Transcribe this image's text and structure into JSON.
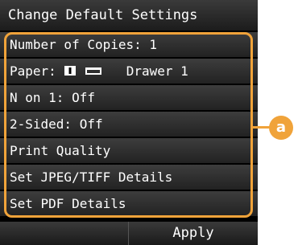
{
  "title": "Change Default Settings",
  "menu_items": [
    {
      "label": "Number of Copies: 1"
    },
    {
      "label": "Paper:",
      "detail": "Drawer 1"
    },
    {
      "label": "N on 1: Off"
    },
    {
      "label": "2-Sided: Off"
    },
    {
      "label": "Print Quality"
    },
    {
      "label": "Set JPEG/TIFF Details"
    },
    {
      "label": "Set PDF Details"
    }
  ],
  "paper_icons": [
    "drawer-number-icon",
    "paper-orientation-icon"
  ],
  "callout": {
    "label": "a",
    "color": "#f0a33a"
  },
  "bottom_bar": {
    "apply_label": "Apply"
  }
}
